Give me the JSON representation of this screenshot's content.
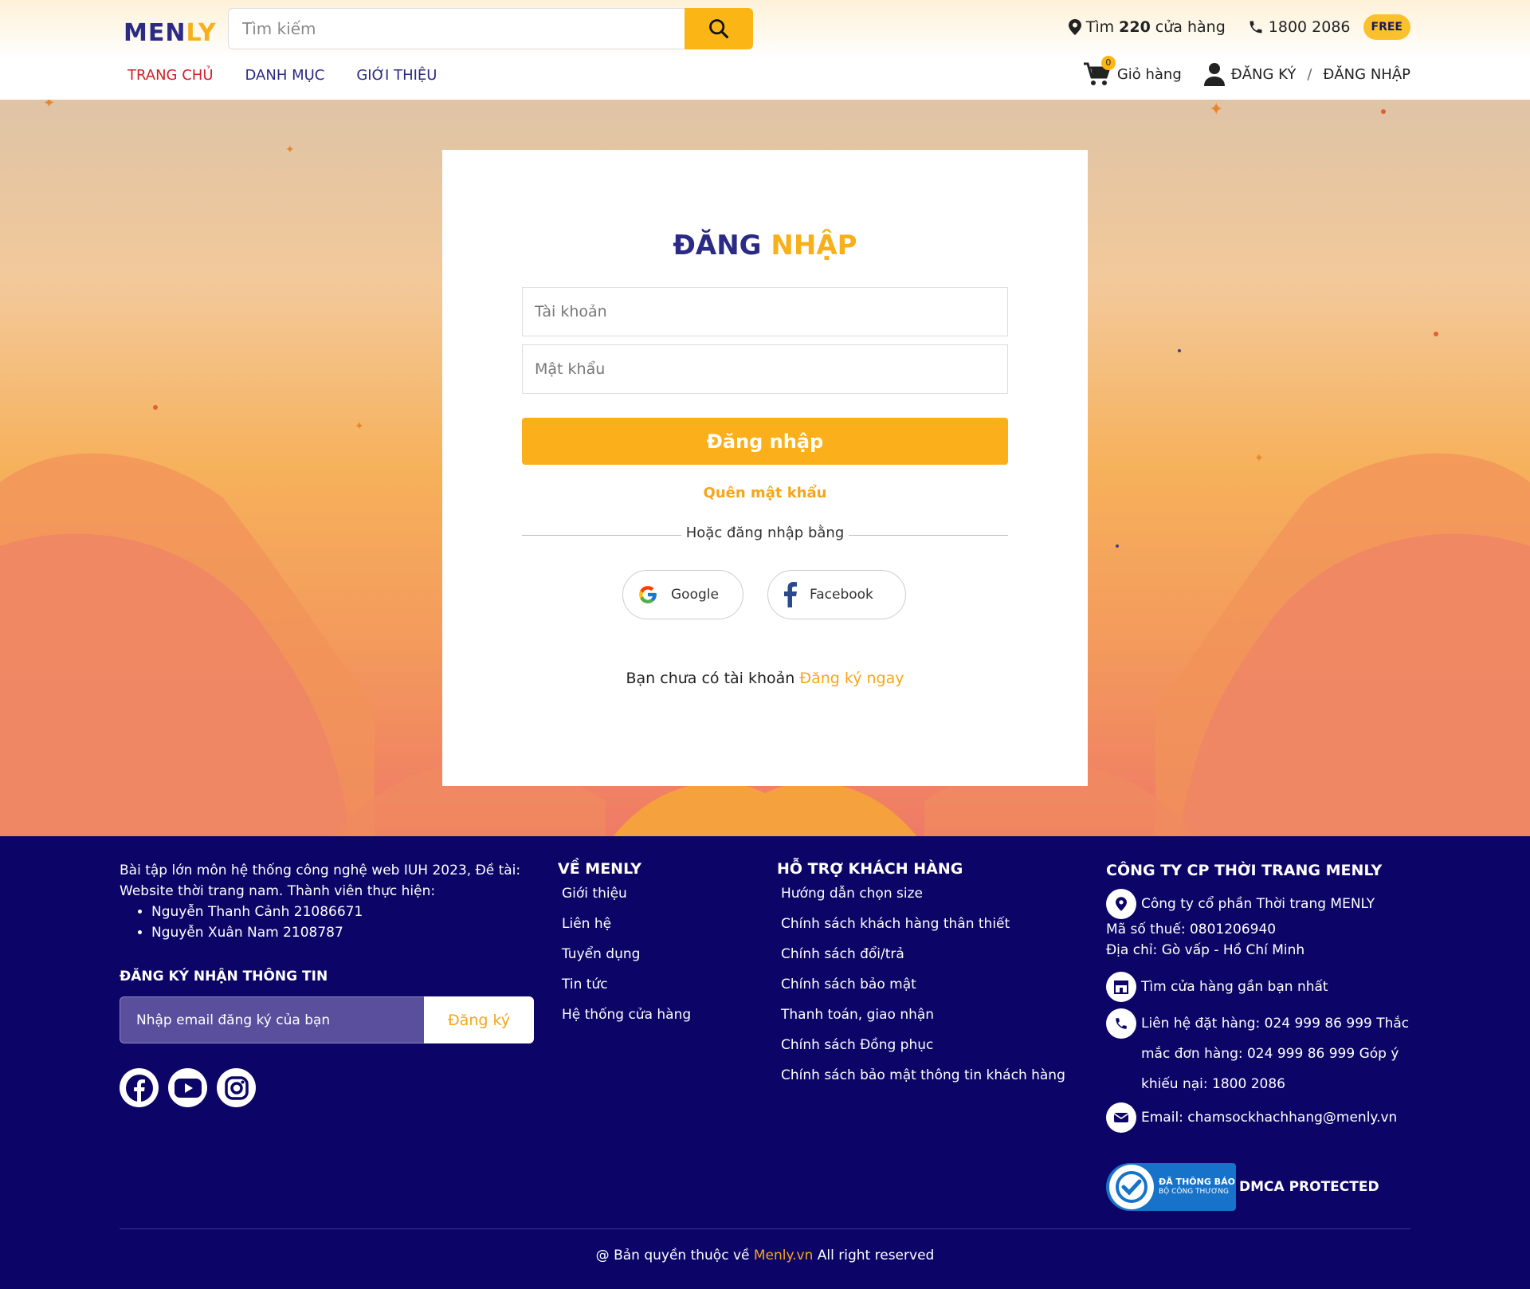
{
  "header": {
    "logo_part1": "MEN",
    "logo_part2": "LY",
    "search_placeholder": "Tìm kiếm",
    "store_prefix": "Tìm",
    "store_count": "220",
    "store_suffix": "cửa hàng",
    "hotline": "1800 2086",
    "free_badge": "FREE",
    "nav": [
      "TRANG CHỦ",
      "DANH MỤC",
      "GIỚI THIỆU"
    ],
    "cart_count": "0",
    "cart_label": "Giỏ hàng",
    "register": "ĐĂNG KÝ",
    "separator": "/",
    "login": "ĐĂNG NHẬP"
  },
  "login_card": {
    "title_part1": "ĐĂNG",
    "title_part2": "NHẬP",
    "username_placeholder": "Tài khoản",
    "password_placeholder": "Mật khẩu",
    "submit": "Đăng nhập",
    "forgot": "Quên mật khẩu",
    "or_text": "Hoặc đăng nhập bằng",
    "google": "Google",
    "facebook": "Facebook",
    "no_account": "Bạn chưa có tài khoản",
    "signup_now": "Đăng ký ngay"
  },
  "footer": {
    "intro": "Bài tập lớn môn hệ thống công nghệ web IUH 2023, Đề tài: Website thời trang nam. Thành viên thực hiện:",
    "members": [
      "Nguyễn Thanh Cảnh 21086671",
      "Nguyễn Xuân Nam 2108787"
    ],
    "subscribe_heading": "ĐĂNG KÝ NHẬN THÔNG TIN",
    "subscribe_placeholder": "Nhập email đăng ký của bạn",
    "subscribe_button": "Đăng ký",
    "about_heading": "VỀ MENLY",
    "about_links": [
      "Giới thiệu",
      "Liên hệ",
      "Tuyển dụng",
      "Tin tức",
      "Hệ thống cửa hàng"
    ],
    "support_heading": "HỖ TRỢ KHÁCH HÀNG",
    "support_links": [
      "Hướng dẫn chọn size",
      "Chính sách khách hàng thân thiết",
      "Chính sách đổi/trả",
      "Chính sách bảo mật",
      "Thanh toán, giao nhận",
      "Chính sách Đồng phục",
      "Chính sách bảo mật thông tin khách hàng"
    ],
    "company_heading": "CÔNG TY CP THỜI TRANG MENLY",
    "company_name": "Công ty cổ phần Thời trang MENLY",
    "tax_code": "Mã số thuế: 0801206940",
    "address": "Địa chỉ: Gò vấp - Hồ Chí Minh",
    "find_store": "Tìm cửa hàng gần bạn nhất",
    "contact": "Liên hệ đặt hàng: 024 999 86 999 Thắc mắc đơn hàng: 024 999 86 999 Góp ý khiếu nại: 1800 2086",
    "email": "Email: chamsockhachhang@menly.vn",
    "bct_line1": "ĐÃ THÔNG BÁO",
    "bct_line2": "BỘ CÔNG THƯƠNG",
    "dmca": "DMCA PROTECTED",
    "copyright_prefix": "@ Bản quyền thuộc về",
    "copyright_link": "Menly.vn",
    "copyright_suffix": "All right reserved"
  }
}
